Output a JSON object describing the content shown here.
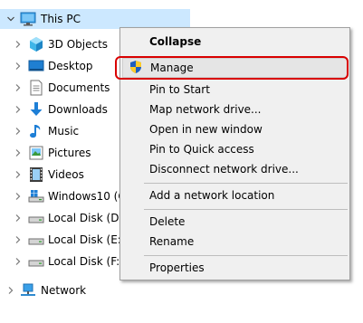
{
  "tree": {
    "root": {
      "label": "This PC",
      "icon": "monitor-icon"
    },
    "items": [
      {
        "label": "3D Objects",
        "icon": "3d-objects-icon"
      },
      {
        "label": "Desktop",
        "icon": "desktop-icon"
      },
      {
        "label": "Documents",
        "icon": "documents-icon"
      },
      {
        "label": "Downloads",
        "icon": "downloads-icon"
      },
      {
        "label": "Music",
        "icon": "music-icon"
      },
      {
        "label": "Pictures",
        "icon": "pictures-icon"
      },
      {
        "label": "Videos",
        "icon": "videos-icon"
      },
      {
        "label": "Windows10 (C",
        "icon": "windows-drive-icon"
      },
      {
        "label": "Local Disk (D:)",
        "icon": "drive-icon"
      },
      {
        "label": "Local Disk (E:)",
        "icon": "drive-icon"
      },
      {
        "label": "Local Disk (F:)",
        "icon": "drive-icon"
      }
    ],
    "network": {
      "label": "Network",
      "icon": "network-icon"
    }
  },
  "context_menu": {
    "items": [
      {
        "label": "Collapse",
        "bold": true
      },
      {
        "label": "Manage",
        "icon": "shield-icon",
        "highlighted": true
      },
      {
        "label": "Pin to Start"
      },
      {
        "label": "Map network drive..."
      },
      {
        "label": "Open in new window"
      },
      {
        "label": "Pin to Quick access"
      },
      {
        "label": "Disconnect network drive..."
      },
      {
        "label": "Add a network location"
      },
      {
        "label": "Delete"
      },
      {
        "label": "Rename"
      },
      {
        "label": "Properties"
      }
    ]
  },
  "colors": {
    "selection": "#cce8ff",
    "menu_background": "#f0f0f0",
    "highlight_box": "#d90000"
  }
}
